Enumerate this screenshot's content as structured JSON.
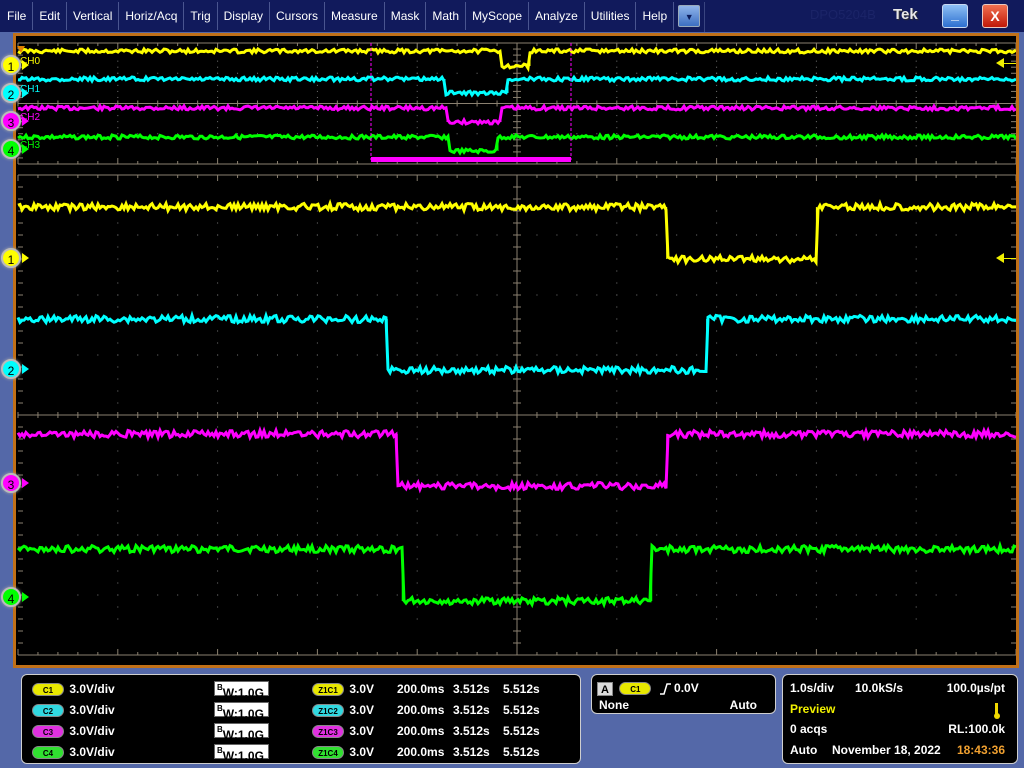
{
  "menubar": {
    "items": [
      "File",
      "Edit",
      "Vertical",
      "Horiz/Acq",
      "Trig",
      "Display",
      "Cursors",
      "Measure",
      "Mask",
      "Math",
      "MyScope",
      "Analyze",
      "Utilities",
      "Help"
    ],
    "dropdown_icon": "triangle-down",
    "model": "DPO5204B",
    "brand": "Tek",
    "minimize_label": "_",
    "close_label": "X"
  },
  "overview": {
    "channels": [
      {
        "marker": "1",
        "label": "CH0",
        "color": "#ffff00"
      },
      {
        "marker": "2",
        "label": "CH1",
        "color": "#00ffff"
      },
      {
        "marker": "3",
        "label": "CH2",
        "color": "#ff00ff"
      },
      {
        "marker": "4",
        "label": "CH3",
        "color": "#00ff00"
      }
    ]
  },
  "zoom_window": {
    "channels": [
      {
        "marker": "1",
        "color": "#ffff00",
        "low_from_div": 6.5,
        "low_to_div": 8.0
      },
      {
        "marker": "2",
        "color": "#00ffff",
        "low_from_div": 3.7,
        "low_to_div": 6.9
      },
      {
        "marker": "3",
        "color": "#ff00ff",
        "low_from_div": 3.8,
        "low_to_div": 6.5
      },
      {
        "marker": "4",
        "color": "#00ff00",
        "low_from_div": 3.85,
        "low_to_div": 6.35
      }
    ]
  },
  "channel_panel": {
    "rows": [
      {
        "badge": "C1",
        "scale": "3.0V/div",
        "bw_prefix": "B",
        "bw_sub": "W",
        "bw": ":1.0G",
        "zbadge": "Z1C1",
        "zscale": "3.0V",
        "zdiv": "200.0ms",
        "zstart": "3.512s",
        "zend": "5.512s",
        "color": "#e8e800"
      },
      {
        "badge": "C2",
        "scale": "3.0V/div",
        "bw_prefix": "B",
        "bw_sub": "W",
        "bw": ":1.0G",
        "zbadge": "Z1C2",
        "zscale": "3.0V",
        "zdiv": "200.0ms",
        "zstart": "3.512s",
        "zend": "5.512s",
        "color": "#30d8e0"
      },
      {
        "badge": "C3",
        "scale": "3.0V/div",
        "bw_prefix": "B",
        "bw_sub": "W",
        "bw": ":1.0G",
        "zbadge": "Z1C3",
        "zscale": "3.0V",
        "zdiv": "200.0ms",
        "zstart": "3.512s",
        "zend": "5.512s",
        "color": "#e030e0"
      },
      {
        "badge": "C4",
        "scale": "3.0V/div",
        "bw_prefix": "B",
        "bw_sub": "W",
        "bw": ":1.0G",
        "zbadge": "Z1C4",
        "zscale": "3.0V",
        "zdiv": "200.0ms",
        "zstart": "3.512s",
        "zend": "5.512s",
        "color": "#30e030"
      }
    ]
  },
  "trigger_panel": {
    "event": "A",
    "source": "C1",
    "slope_icon": "rising-edge",
    "level": "0.0V",
    "mode_left": "None",
    "mode_right": "Auto"
  },
  "acq_panel": {
    "time_div": "1.0s/div",
    "sample_rate": "10.0kS/s",
    "resolution": "100.0µs/pt",
    "state": "Preview",
    "acqs": "0 acqs",
    "record_length": "RL:100.0k",
    "trigger_mode": "Auto",
    "date": "November 18, 2022",
    "time": "18:43:36"
  }
}
